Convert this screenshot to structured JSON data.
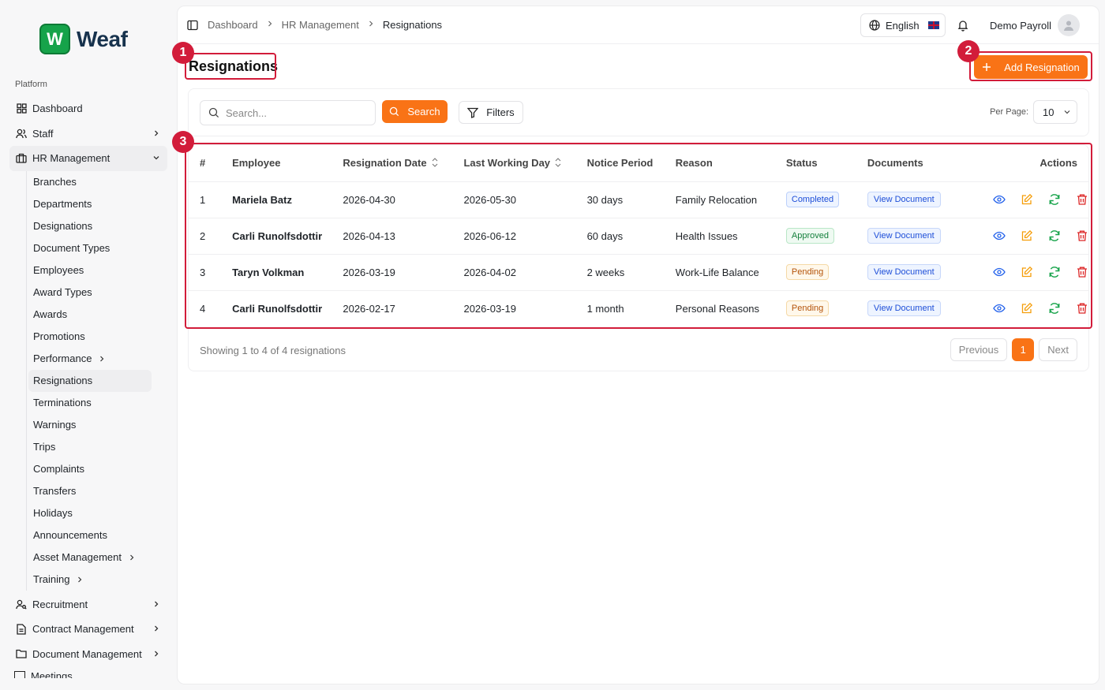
{
  "brand": {
    "logo_letter": "W",
    "name": "Weaf"
  },
  "sidebar": {
    "group_label": "Platform",
    "items": [
      {
        "label": "Dashboard"
      },
      {
        "label": "Staff"
      },
      {
        "label": "HR Management"
      }
    ],
    "hr_sub": [
      {
        "label": "Branches"
      },
      {
        "label": "Departments"
      },
      {
        "label": "Designations"
      },
      {
        "label": "Document Types"
      },
      {
        "label": "Employees"
      },
      {
        "label": "Award Types"
      },
      {
        "label": "Awards"
      },
      {
        "label": "Promotions"
      },
      {
        "label": "Performance"
      },
      {
        "label": "Resignations"
      },
      {
        "label": "Terminations"
      },
      {
        "label": "Warnings"
      },
      {
        "label": "Trips"
      },
      {
        "label": "Complaints"
      },
      {
        "label": "Transfers"
      },
      {
        "label": "Holidays"
      },
      {
        "label": "Announcements"
      },
      {
        "label": "Asset Management"
      },
      {
        "label": "Training"
      }
    ],
    "bottom_items": [
      {
        "label": "Recruitment"
      },
      {
        "label": "Contract Management"
      },
      {
        "label": "Document Management"
      }
    ],
    "clipped_item": "Meetings"
  },
  "header": {
    "breadcrumbs": [
      "Dashboard",
      "HR Management",
      "Resignations"
    ],
    "language": "English",
    "user_name": "Demo Payroll"
  },
  "page": {
    "title": "Resignations",
    "add_button": "Add Resignation"
  },
  "toolbar": {
    "search_placeholder": "Search...",
    "search_button": "Search",
    "filters_button": "Filters",
    "per_page_label": "Per Page:",
    "per_page_value": "10"
  },
  "table": {
    "columns": [
      "#",
      "Employee",
      "Resignation Date",
      "Last Working Day",
      "Notice Period",
      "Reason",
      "Status",
      "Documents",
      "Actions"
    ],
    "rows": [
      {
        "num": "1",
        "employee": "Mariela Batz",
        "resignation_date": "2026-04-30",
        "last_day": "2026-05-30",
        "notice": "30 days",
        "reason": "Family Relocation",
        "status": "Completed",
        "document": "View Document"
      },
      {
        "num": "2",
        "employee": "Carli Runolfsdottir",
        "resignation_date": "2026-04-13",
        "last_day": "2026-06-12",
        "notice": "60 days",
        "reason": "Health Issues",
        "status": "Approved",
        "document": "View Document"
      },
      {
        "num": "3",
        "employee": "Taryn Volkman",
        "resignation_date": "2026-03-19",
        "last_day": "2026-04-02",
        "notice": "2 weeks",
        "reason": "Work-Life Balance",
        "status": "Pending",
        "document": "View Document"
      },
      {
        "num": "4",
        "employee": "Carli Runolfsdottir",
        "resignation_date": "2026-02-17",
        "last_day": "2026-03-19",
        "notice": "1 month",
        "reason": "Personal Reasons",
        "status": "Pending",
        "document": "View Document"
      }
    ]
  },
  "pagination": {
    "summary": "Showing 1 to 4 of 4 resignations",
    "previous": "Previous",
    "current": "1",
    "next": "Next"
  },
  "annotations": [
    "1",
    "2",
    "3"
  ],
  "colors": {
    "accent": "#f97316",
    "annotation": "#d21c3a",
    "brand": "#16a34a"
  },
  "icons": [
    "sidebar-toggle-icon",
    "globe-icon",
    "uk-flag-icon",
    "bell-icon",
    "user-icon",
    "search-icon",
    "filter-icon",
    "plus-icon",
    "chevron-down-icon",
    "sort-icon",
    "eye-icon",
    "edit-icon",
    "refresh-icon",
    "trash-icon"
  ]
}
